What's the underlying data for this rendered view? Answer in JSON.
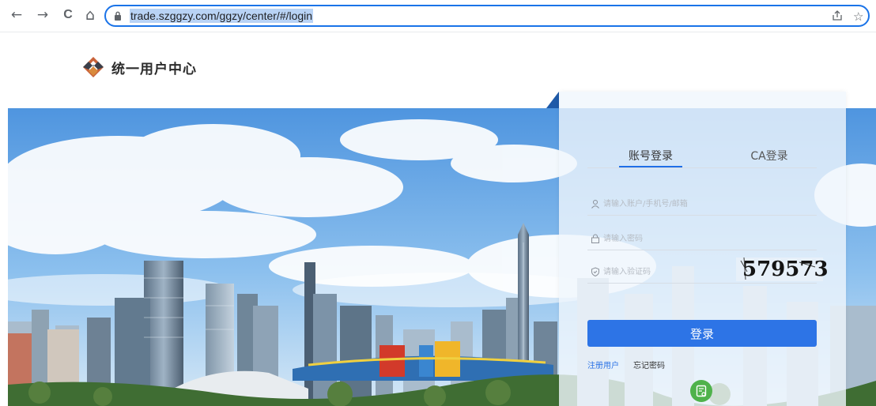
{
  "browser": {
    "back": "←",
    "forward": "→",
    "reload": "C",
    "home": "⌂",
    "url": "trade.szggzy.com/ggzy/center/#/login",
    "share_icon": "share-icon",
    "bookmark_icon": "star-icon"
  },
  "header": {
    "title": "统一用户中心",
    "logo_icon": "diamond-logo-icon"
  },
  "login": {
    "tabs": [
      {
        "label": "账号登录",
        "active": true
      },
      {
        "label": "CA登录",
        "active": false
      }
    ],
    "username_placeholder": "请输入账户/手机号/邮箱",
    "password_placeholder": "请输入密码",
    "captcha_placeholder": "请输入验证码",
    "captcha_code": "579573",
    "submit_label": "登录",
    "register_label": "注册用户",
    "forgot_label": "忘记密码",
    "help_icon": "document-icon"
  },
  "colors": {
    "accent": "#2d74e6",
    "help_green": "#4fb24b",
    "url_highlight": "#b9d3f5"
  }
}
